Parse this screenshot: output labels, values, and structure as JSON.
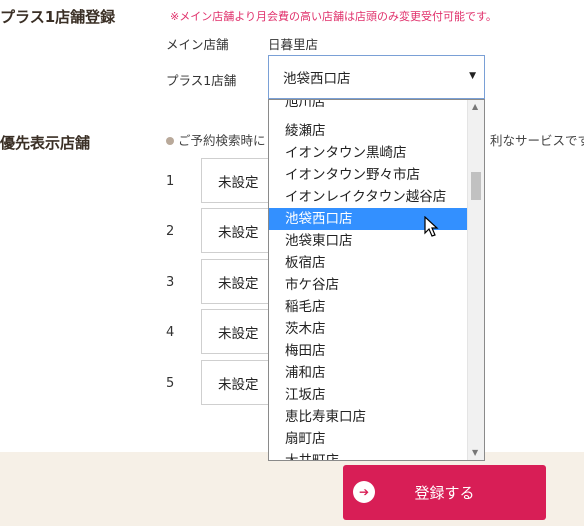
{
  "plus_store": {
    "title": "プラス1店舗登録",
    "notice": "※メイン店舗より月会費の高い店舗は店頭のみ変更受付可能です。",
    "main_store_label": "メイン店舗",
    "main_store_value": "日暮里店",
    "plus_store_label": "プラス1店舗",
    "plus_store_selected": "池袋西口店"
  },
  "priority": {
    "title": "優先表示店舗",
    "description_left": "ご予約検索時に",
    "description_right": "利なサービスです",
    "rows": [
      {
        "num": "1",
        "value": "未設定"
      },
      {
        "num": "2",
        "value": "未設定"
      },
      {
        "num": "3",
        "value": "未設定"
      },
      {
        "num": "4",
        "value": "未設定"
      },
      {
        "num": "5",
        "value": "未設定"
      }
    ]
  },
  "dropdown": {
    "options": [
      "旭川店",
      "綾瀬店",
      "イオンタウン黒崎店",
      "イオンタウン野々市店",
      "イオンレイクタウン越谷店",
      "池袋西口店",
      "池袋東口店",
      "板宿店",
      "市ケ谷店",
      "稲毛店",
      "茨木店",
      "梅田店",
      "浦和店",
      "江坂店",
      "恵比寿東口店",
      "扇町店",
      "大井町店"
    ],
    "selected_index": 5
  },
  "footer": {
    "register_label": "登録する"
  },
  "colors": {
    "accent": "#d81e56",
    "notice": "#e0306b",
    "selection": "#3390ff",
    "footer_bg": "#f6f0e7"
  }
}
